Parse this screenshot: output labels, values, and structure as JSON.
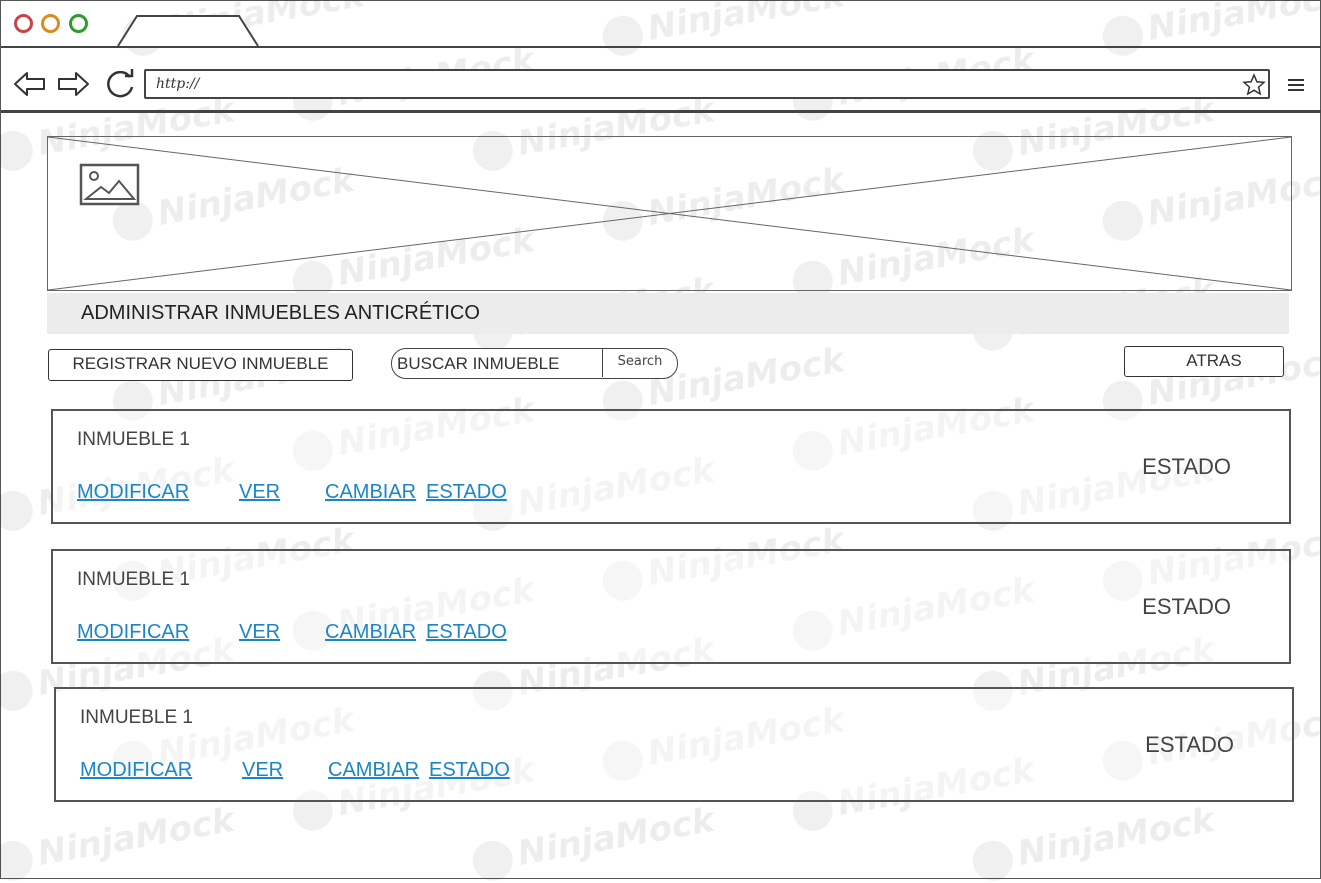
{
  "browser": {
    "url": "http://",
    "dot_colors": [
      "#c8434a",
      "#d98c1f",
      "#2f9a2f"
    ]
  },
  "watermark": {
    "text": "NinjaMock"
  },
  "icons": {
    "back": "arrow-left-icon",
    "forward": "arrow-right-icon",
    "reload": "reload-icon",
    "bookmark": "star-icon",
    "menu": "hamburger-menu-icon",
    "banner": "image-icon"
  },
  "page": {
    "title": "ADMINISTRAR INMUEBLES ANTICRÉTICO"
  },
  "toolbar": {
    "register_label": "REGISTRAR NUEVO INMUEBLE",
    "search_placeholder": "BUSCAR INMUEBLE",
    "search_button": "Search",
    "back_label": "ATRAS"
  },
  "properties": [
    {
      "title": "INMUEBLE 1",
      "status": "ESTADO",
      "actions": {
        "modify": "MODIFICAR",
        "view": "VER",
        "change": "CAMBIAR",
        "state": "ESTADO"
      }
    },
    {
      "title": "INMUEBLE 1",
      "status": "ESTADO",
      "actions": {
        "modify": "MODIFICAR",
        "view": "VER",
        "change": "CAMBIAR",
        "state": "ESTADO"
      }
    },
    {
      "title": "INMUEBLE 1",
      "status": "ESTADO",
      "actions": {
        "modify": "MODIFICAR",
        "view": "VER",
        "change": "CAMBIAR",
        "state": "ESTADO"
      }
    }
  ],
  "colors": {
    "link": "#1a86c9",
    "header_bg": "#ececec",
    "border": "#555555"
  }
}
